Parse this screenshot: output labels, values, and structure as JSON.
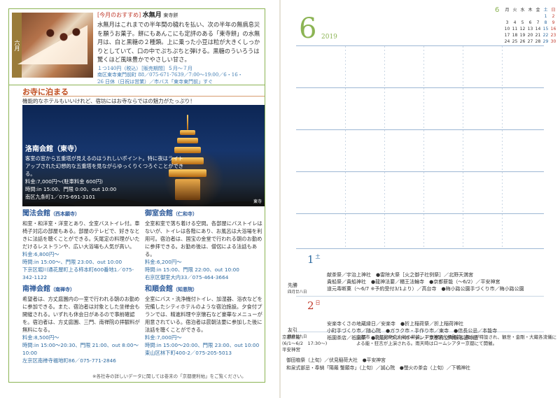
{
  "left": {
    "feature": {
      "month_tag": "六月",
      "recommend": "[今月のおすすめ]",
      "name": "水無月",
      "maker": "東寺餅",
      "body": "水無月はこれまでの半年間の穢れを払い、次の半年の無病息災を願うお菓子。餅にもあんこにも定評のある「東寺餅」の水無月は、白と黒糖の２種類。上に乗った小豆は粒が大きくしっかりとしていて、口の中でぷちぷちと弾ける。黒糖のういろうは驚くほど風味豊かでやさしい甘さ。",
      "price": "１つ140円（税込）［販売期間］５月～７月",
      "addr1": "南区東寺東門前町 88／075-671-7639／7:00～19:00／6・16・",
      "addr2": "26 日休（日祝は営業）／市バス「東寺東門前」すぐ"
    },
    "section": {
      "title": "お寺に泊まる",
      "subtitle": "機能的なホテルもいいけれど、宿坊にはお寺ならではの魅力がたっぷり！"
    },
    "photo": {
      "title": "洛南会館（東寺）",
      "desc": "客室の窓から五重塔が見えるのはうれしいポイント。特に夜はライトアップされた幻想的な五重塔を見ながらゆっくりくつろぐことができる。",
      "price": "料金:7,000円～(駐車料金 600円)",
      "time": "時間:in 15:00、門限 0:00、out 10:00",
      "addr": "南区九条町1／075-691-3101",
      "caption": "東寺"
    },
    "temples": [
      {
        "name": "聞法会館",
        "sub": "（西本願寺）",
        "desc": "和室・和洋室・洋室とあり、全室バストイレ付。車椅子対応の部屋もある。部屋のテレビで、好きなときに法話を聴くことができる。矢尾定の料理がいただけるレストランや、広い大浴場も人気が高い。",
        "price": "料金:6,800円～",
        "time": "時間:in 15:00～、門限 23:00、out 10:00",
        "addr": "下京区堀川通花屋町上る柿本町600番地1／075-342-1122"
      },
      {
        "name": "御室会館",
        "sub": "（仁和寺）",
        "desc": "全室和室で落ち着ける空間。各部屋にバストイレはないが、トイレは各階にあり、お風呂は大浴場を利用可。宿泊者は、国宝の金堂で行われる朝のお勤めに参拝できる。お勤め後は、僧侶による法話もある。",
        "price": "料金:6,200円～",
        "time": "時間:in 15:00、門限 22:00、out 10:00",
        "addr": "右京区御室大内33／075-464-3664"
      },
      {
        "name": "南禅会館",
        "sub": "（南禅寺）",
        "desc": "希望者は、方丈庭園内の一室で行われる朝のお勤めに参加できる。また、宿泊者は対象とした坐禅会も開催される。いずれも休会日があるので事前確認を。宿泊者は、方丈庭園、三門、南禅院の拝観料が無料になる。",
        "price": "料金:8,500円～",
        "time": "時間:in 15:00～20:30、門限 21:00、out 8:00～10:00",
        "addr": "左京区南禅寺福地町86／075-771-2846"
      },
      {
        "name": "和順会館",
        "sub": "（知恩院）",
        "desc": "全室にバス・洗浄機付トイレ、加湿器、浴衣などを完備したシティホテルのような宿泊施設。夕食付プランでは、精進料理や京懐石など豪華なメニューが用意されている。宿泊者は晨朝法要に参加した後に法話を聴くことができる。",
        "price": "料金:7,000円～",
        "time": "時間:in 15:00～20:00、門限 23:00、out 10:00",
        "addr": "東山区林下町400-2／075-205-5013"
      }
    ],
    "footnote": "※各社寺の詳しいデータに関しては巻末の「京都便利帖」をご覧ください。"
  },
  "right": {
    "month": "6",
    "year": "2019",
    "mini_cal": {
      "month": "6",
      "dow": [
        "月",
        "火",
        "水",
        "木",
        "金",
        "土",
        "日"
      ],
      "rows": [
        [
          "",
          "",
          "",
          "",
          "",
          "1",
          "2"
        ],
        [
          "3",
          "4",
          "5",
          "6",
          "7",
          "8",
          "9"
        ],
        [
          "10",
          "11",
          "12",
          "13",
          "14",
          "15",
          "16"
        ],
        [
          "17",
          "18",
          "19",
          "20",
          "21",
          "22",
          "23"
        ],
        [
          "24",
          "25",
          "26",
          "27",
          "28",
          "29",
          "30"
        ]
      ]
    },
    "day1": {
      "num": "1",
      "dow": "土",
      "rokuyo": "先勝",
      "kyureki": "四月廿八日",
      "events": [
        "献茶祭／宇治上神社　●雷除大祭［火之御子社例祭］／北野天満宮",
        "貴船祭／貴船神社　●龍神法要／櫃王法輪寺　●京都薪能（～6/2）／平安神宮",
        "道元毒断菓（～6/7 ※予約受付3/1より）／高台寺　●梅小路公園手づくり市／梅小路公園"
      ]
    },
    "day2": {
      "num": "2",
      "dow": "日",
      "rokuyo": "友引",
      "kyureki": "四月廿九日",
      "events": [
        "安楽寺くさの地蔵縁日／安楽寺　●折上稲荷祭／折上稲荷神社",
        "小町手づくり市／随心院　●ガラク市・手作り市／東寺　●信長公忌／本能寺",
        "祇園茶店／祇園祭　●北山クラフトガーデン／京都府立陶板名画の庭"
      ]
    },
    "kn": {
      "title": "京都薪能",
      "dates": "(6/1～6/2　17:30～)",
      "place": "平安神宮",
      "desc": "京都市・京都能楽会主催の薪能。平安神宮大極殿前に舞台が特設され、観世・金剛・大蔵各流儀による能・狂言が上演される。雨天時はロームシアター京都にて開催。"
    },
    "bottom_events": [
      "御田植祭（上旬）／伏見稲荷大社　●平安神宮",
      "和泉式部忌・奉納「陽羅 蟹願寺」（上旬）／誠心院　●螢火の茶会（上旬）／下鴨神社"
    ]
  },
  "colors": {
    "accent_green": "#8cb454",
    "accent_blue": "#2d6aa0",
    "accent_red": "#c0392b"
  }
}
